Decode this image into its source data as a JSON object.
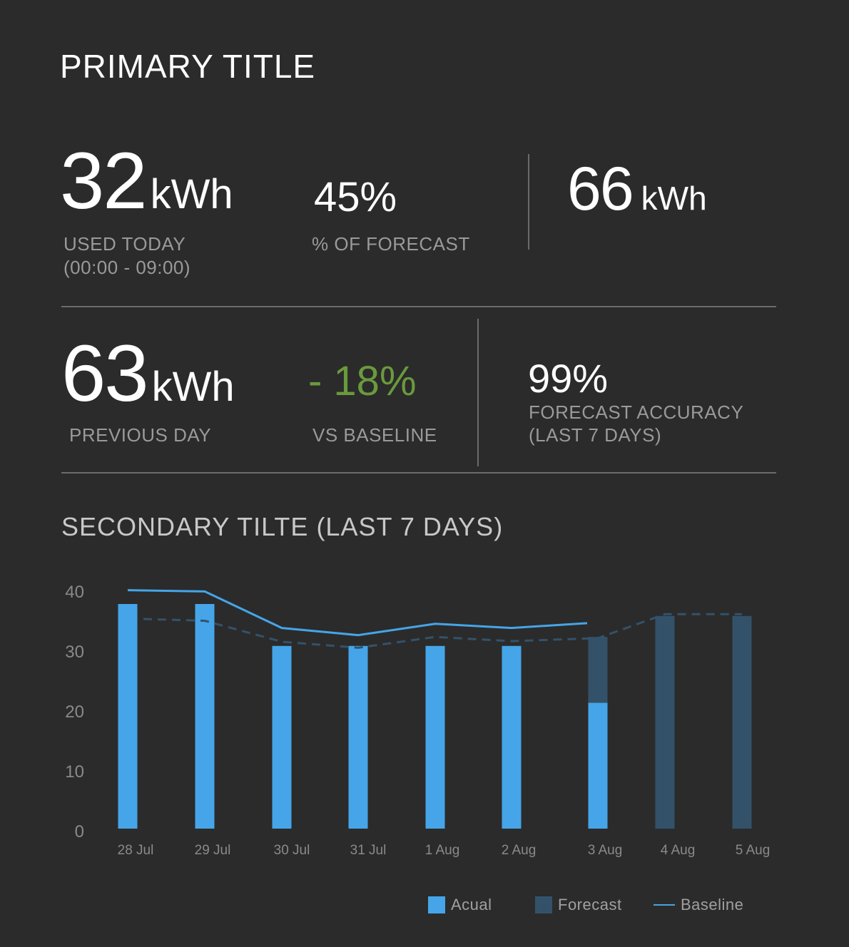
{
  "header": {
    "title": "PRIMARY TITLE"
  },
  "kpis": {
    "used_today": {
      "value": "32",
      "unit": "kWh",
      "label": "USED TODAY",
      "sublabel": "(00:00 - 09:00)"
    },
    "pct_forecast": {
      "value": "45%",
      "label": "% OF FORECAST"
    },
    "forecast_total": {
      "value": "66",
      "unit": "kWh"
    },
    "previous_day": {
      "value": "63",
      "unit": "kWh",
      "label": "PREVIOUS DAY"
    },
    "vs_baseline": {
      "value": "- 18%",
      "label": "VS BASELINE",
      "color": "#6a9a3c"
    },
    "forecast_accuracy": {
      "value": "99%",
      "label": "FORECAST ACCURACY",
      "sublabel": "(LAST 7 DAYS)"
    }
  },
  "section": {
    "title": "SECONDARY TILTE (LAST 7 DAYS)"
  },
  "legend": {
    "actual": "Acual",
    "forecast": "Forecast",
    "baseline": "Baseline"
  },
  "colors": {
    "background": "#2b2b2b",
    "actual": "#45a5e8",
    "forecast": "#33526a",
    "baseline_line": "#45a5e8",
    "forecast_line": "#33526a",
    "accent_green": "#6a9a3c"
  },
  "chart_data": {
    "type": "bar",
    "categories": [
      "28 Jul",
      "29 Jul",
      "30 Jul",
      "31 Jul",
      "1 Aug",
      "2 Aug",
      "3 Aug",
      "4 Aug",
      "5 Aug"
    ],
    "series": [
      {
        "name": "Acual",
        "type": "bar",
        "values": [
          37.5,
          37.5,
          30.5,
          30.5,
          30.5,
          30.5,
          21,
          null,
          null
        ]
      },
      {
        "name": "Forecast",
        "type": "bar",
        "values": [
          null,
          null,
          null,
          null,
          null,
          null,
          32,
          35.5,
          35.5
        ]
      },
      {
        "name": "Baseline",
        "type": "line",
        "values": [
          39.8,
          39.6,
          33.5,
          32.3,
          34.2,
          33.5,
          34.3,
          null,
          null
        ]
      },
      {
        "type": "line",
        "style": "dashed",
        "values": [
          35,
          34.7,
          31.2,
          30.2,
          32,
          31.3,
          31.8,
          35.8,
          35.8
        ]
      }
    ],
    "yticks": [
      0,
      10,
      20,
      30,
      40
    ],
    "ylim": [
      0,
      40
    ],
    "grid": false,
    "legend_position": "bottom-right"
  }
}
